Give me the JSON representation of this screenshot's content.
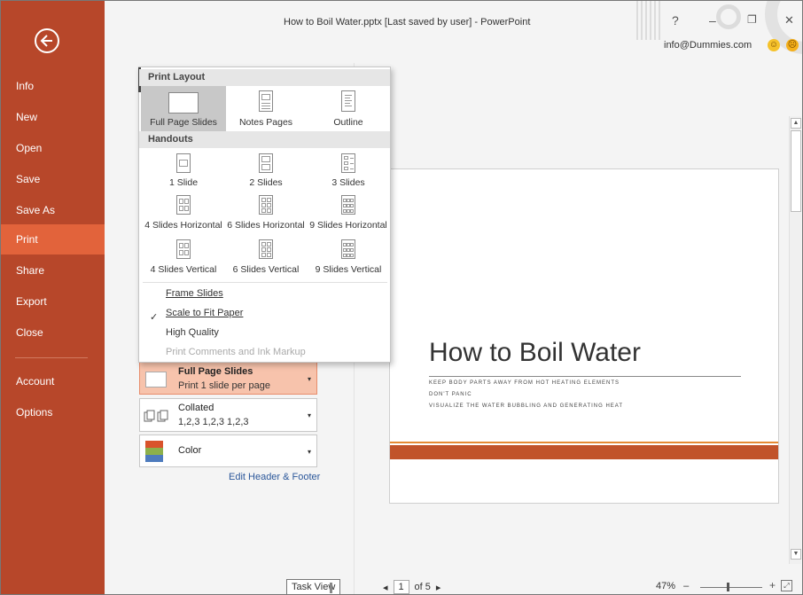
{
  "window": {
    "title": "How to Boil Water.pptx [Last saved by user] - PowerPoint",
    "help": "?",
    "minimize": "–",
    "restore": "❐",
    "close": "✕",
    "user_email": "info@Dummies.com",
    "smile": "☺",
    "frown": "☹"
  },
  "sidebar": {
    "back_icon": "back-arrow-icon",
    "items": [
      {
        "label": "Info"
      },
      {
        "label": "New"
      },
      {
        "label": "Open"
      },
      {
        "label": "Save"
      },
      {
        "label": "Save As"
      },
      {
        "label": "Print"
      },
      {
        "label": "Share"
      },
      {
        "label": "Export"
      },
      {
        "label": "Close"
      },
      {
        "label": "Account"
      },
      {
        "label": "Options"
      }
    ],
    "active": "Print",
    "color": "#b7472a",
    "active_color": "#e2633b"
  },
  "popup": {
    "print_layout_header": "Print Layout",
    "layout_options": [
      {
        "label": "Full Page Slides",
        "selected": true
      },
      {
        "label": "Notes Pages",
        "selected": false
      },
      {
        "label": "Outline",
        "selected": false
      }
    ],
    "handouts_header": "Handouts",
    "handouts": [
      {
        "label": "1 Slide"
      },
      {
        "label": "2 Slides"
      },
      {
        "label": "3 Slides"
      },
      {
        "label": "4 Slides Horizontal"
      },
      {
        "label": "6 Slides Horizontal"
      },
      {
        "label": "9 Slides Horizontal"
      },
      {
        "label": "4 Slides Vertical"
      },
      {
        "label": "6 Slides Vertical"
      },
      {
        "label": "9 Slides Vertical"
      }
    ],
    "frame_slides": "Frame Slides",
    "scale_to_fit": "Scale to Fit Paper",
    "scale_checked": true,
    "check_mark": "✓",
    "high_quality": "High Quality",
    "print_comments": "Print Comments and Ink Markup"
  },
  "settings": {
    "layout_dropdown": {
      "title": "Full Page Slides",
      "subtitle": "Print 1 slide per page"
    },
    "collate_dropdown": {
      "title": "Collated",
      "subtitle": "1,2,3   1,2,3   1,2,3"
    },
    "color_dropdown": {
      "title": "Color"
    },
    "edit_header_footer": "Edit Header & Footer",
    "caret": "▾"
  },
  "slide": {
    "title": "How to Boil Water",
    "bullets": [
      "KEEP BODY PARTS AWAY FROM HOT HEATING ELEMENTS",
      "DON'T PANIC",
      "VISUALIZE THE WATER BUBBLING  AND GENERATING HEAT"
    ],
    "accent_color": "#c1532a",
    "stripe_color": "#e58a33"
  },
  "footer": {
    "tooltip": "Task View",
    "prev": "◂",
    "current_page": "1",
    "of_pages": "of 5",
    "next": "▸",
    "zoom": "47%",
    "zoom_minus": "–",
    "zoom_plus": "+",
    "fit": "⤢"
  },
  "scroll": {
    "up": "▲",
    "down": "▼"
  }
}
